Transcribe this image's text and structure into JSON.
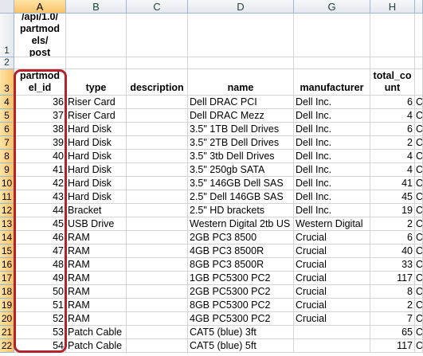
{
  "columns": [
    "A",
    "B",
    "C",
    "D",
    "G",
    "H"
  ],
  "row_numbers": [
    "1",
    "2",
    "3",
    "4",
    "5",
    "6",
    "7",
    "8",
    "9",
    "10",
    "11",
    "12",
    "13",
    "14",
    "15",
    "16",
    "17",
    "18",
    "19",
    "20",
    "21",
    "22"
  ],
  "a1_text": "/api/1.0/\npartmod\nels/\npost",
  "headers": {
    "a": "partmod\nel_id",
    "b": "type",
    "c": "description",
    "d": "name",
    "g": "manufacturer",
    "h": "total_co\nunt"
  },
  "rows": [
    {
      "id": "36",
      "type": "Riser Card",
      "name": "Dell DRAC PCI",
      "mfr": "Dell Inc.",
      "count": "6",
      "next": "C"
    },
    {
      "id": "37",
      "type": "Riser Card",
      "name": "Dell DRAC Mezz",
      "mfr": "Dell Inc.",
      "count": "4",
      "next": "C"
    },
    {
      "id": "38",
      "type": "Hard Disk",
      "name": "3.5\" 1TB Dell Drives",
      "mfr": "Dell Inc.",
      "count": "6",
      "next": "C"
    },
    {
      "id": "39",
      "type": "Hard Disk",
      "name": "3.5\" 2TB Dell Drives",
      "mfr": "Dell Inc.",
      "count": "2",
      "next": "C"
    },
    {
      "id": "40",
      "type": "Hard Disk",
      "name": "3.5\" 3tb Dell Drives",
      "mfr": "Dell Inc.",
      "count": "4",
      "next": "C"
    },
    {
      "id": "41",
      "type": "Hard Disk",
      "name": "3.5\" 250gb SATA",
      "mfr": "Dell Inc.",
      "count": "4",
      "next": "C"
    },
    {
      "id": "42",
      "type": "Hard Disk",
      "name": "3.5\" 146GB Dell SAS",
      "mfr": "Dell Inc.",
      "count": "41",
      "next": "C"
    },
    {
      "id": "43",
      "type": "Hard Disk",
      "name": "2.5\" Dell 146GB SAS",
      "mfr": "Dell Inc.",
      "count": "45",
      "next": "C"
    },
    {
      "id": "44",
      "type": "Bracket",
      "name": "2.5\" HD brackets",
      "mfr": "Dell Inc.",
      "count": "19",
      "next": "C"
    },
    {
      "id": "45",
      "type": "USB Drive",
      "name": "Western Digital 2tb US",
      "mfr": "Western Digital",
      "count": "2",
      "next": "C"
    },
    {
      "id": "46",
      "type": "RAM",
      "name": "2GB PC3 8500",
      "mfr": "Crucial",
      "count": "6",
      "next": "C"
    },
    {
      "id": "47",
      "type": "RAM",
      "name": "4GB PC3 8500R",
      "mfr": "Crucial",
      "count": "40",
      "next": "C"
    },
    {
      "id": "48",
      "type": "RAM",
      "name": "8GB PC3 8500R",
      "mfr": "Crucial",
      "count": "33",
      "next": "C"
    },
    {
      "id": "49",
      "type": "RAM",
      "name": "1GB PC5300 PC2",
      "mfr": "Crucial",
      "count": "117",
      "next": "C"
    },
    {
      "id": "50",
      "type": "RAM",
      "name": "2GB PC5300 PC2",
      "mfr": "Crucial",
      "count": "8",
      "next": "C"
    },
    {
      "id": "51",
      "type": "RAM",
      "name": "8GB PC5300 PC2",
      "mfr": "Crucial",
      "count": "2",
      "next": "C"
    },
    {
      "id": "52",
      "type": "RAM",
      "name": "4GB PC5300 PC2",
      "mfr": "Crucial",
      "count": "7",
      "next": "C"
    },
    {
      "id": "53",
      "type": "Patch Cable",
      "name": "CAT5 (blue) 3ft",
      "mfr": "",
      "count": "65",
      "next": "C"
    },
    {
      "id": "54",
      "type": "Patch Cable",
      "name": "CAT5 (blue) 5ft",
      "mfr": "",
      "count": "117",
      "next": "C"
    }
  ],
  "colors": {
    "highlight": "#b3212b",
    "header_bg": "#e4e8ee",
    "selected_header": "#f9c36a",
    "gridline": "#d4d4d4"
  }
}
